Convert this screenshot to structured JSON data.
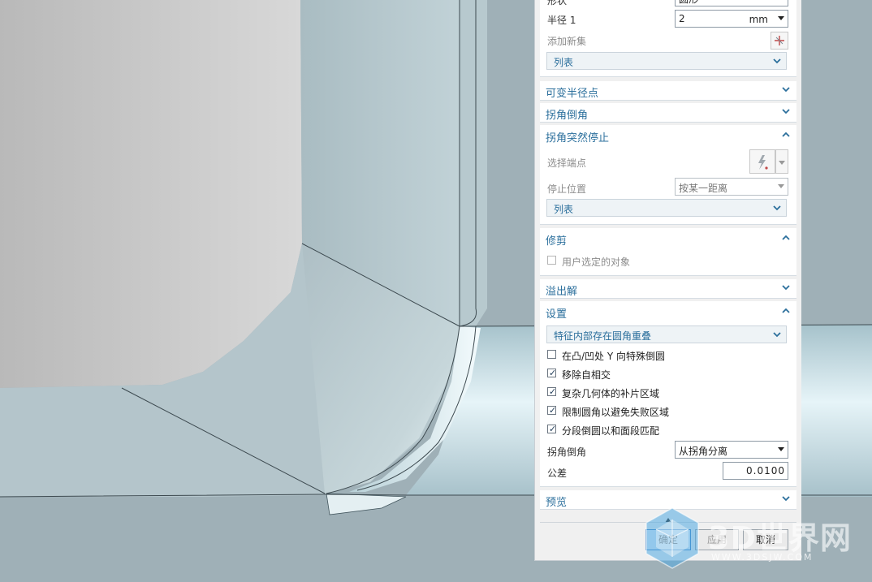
{
  "top_partial": {
    "label": "形状",
    "value": "圆形"
  },
  "radius": {
    "label": "半径 1",
    "value": "2",
    "unit": "mm"
  },
  "add_new_set": {
    "label": "添加新集"
  },
  "list_label": "列表",
  "sections": {
    "variable_radius": "可变半径点",
    "corner_chamfer": "拐角倒角",
    "corner_stop": "拐角突然停止",
    "trim": "修剪",
    "overflow": "溢出解",
    "settings": "设置",
    "preview": "预览"
  },
  "corner_stop": {
    "select_end_label": "选择端点",
    "stop_pos_label": "停止位置",
    "stop_pos_value": "按某一距离",
    "list_label": "列表"
  },
  "trim": {
    "user_selected_label": "用户选定的对象",
    "checked": false
  },
  "settings": {
    "overlap_dropdown": "特征内部存在圆角重叠",
    "checkboxes": [
      {
        "label": "在凸/凹处 Y 向特殊倒圆",
        "checked": false
      },
      {
        "label": "移除自相交",
        "checked": true
      },
      {
        "label": "复杂几何体的补片区域",
        "checked": true
      },
      {
        "label": "限制圆角以避免失败区域",
        "checked": true
      },
      {
        "label": "分段倒圆以和面段匹配",
        "checked": true
      }
    ],
    "corner_chamfer_label": "拐角倒角",
    "corner_chamfer_value": "从拐角分离",
    "tolerance_label": "公差",
    "tolerance_value": "0.0100"
  },
  "buttons": {
    "ok": "确定",
    "apply": "应用",
    "cancel": "取消"
  },
  "watermark": {
    "text": "3D世界网",
    "url": "WWW.3DSJW.COM"
  },
  "colors": {
    "accent": "#2b6f9c",
    "viewport_bg": "#9fb0b7",
    "face_light": "#d9d9d9"
  }
}
